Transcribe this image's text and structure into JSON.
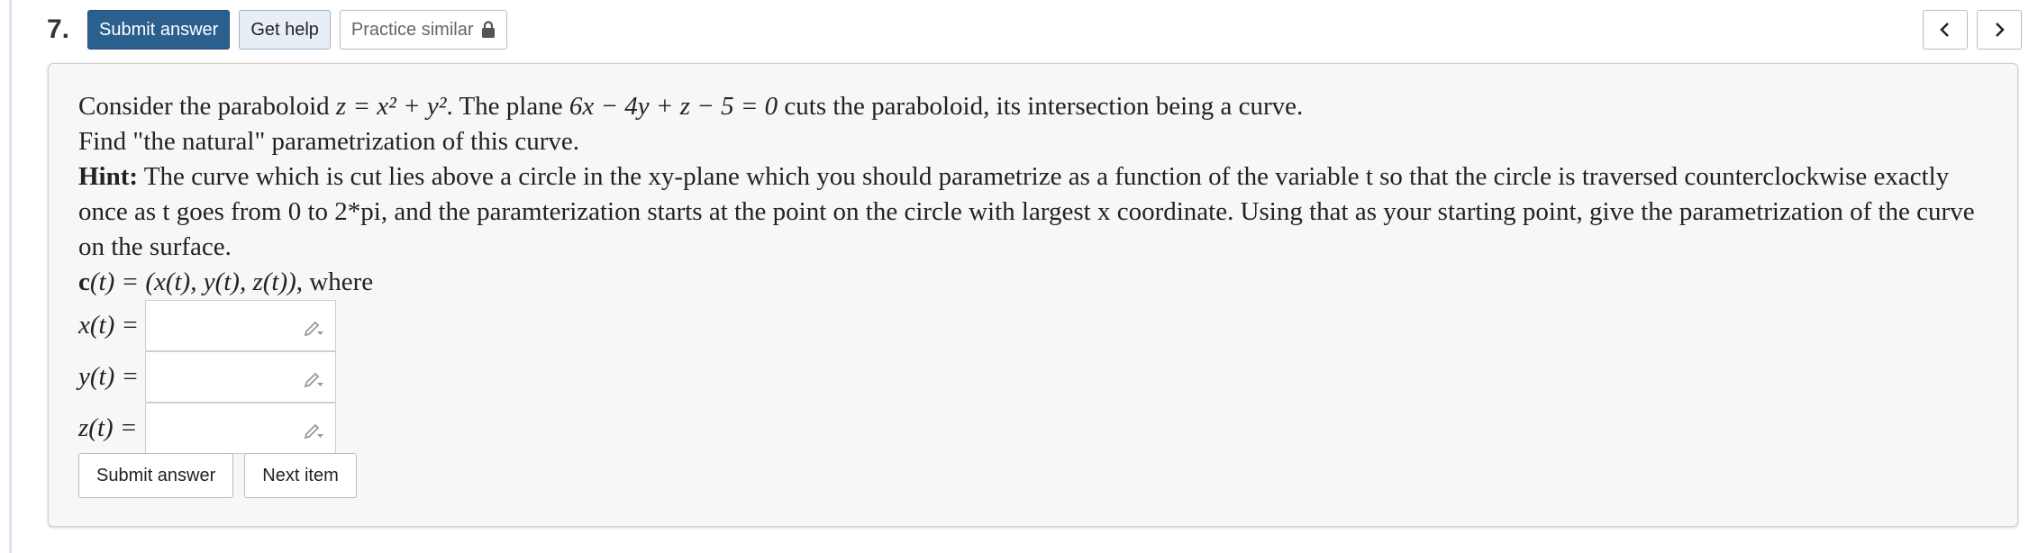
{
  "question": {
    "number": "7.",
    "submit_label": "Submit answer",
    "help_label": "Get help",
    "practice_label": "Practice similar"
  },
  "nav": {
    "prev_icon": "chevron-left-icon",
    "next_icon": "chevron-right-icon"
  },
  "problem": {
    "line1_pre": "Consider the paraboloid ",
    "paraboloid_eq": "z = x² + y²",
    "line1_mid": ". The plane ",
    "plane_eq": "6x − 4y + z − 5 = 0",
    "line1_post": " cuts the paraboloid, its intersection being a curve.",
    "line2": "Find \"the natural\" parametrization of this curve.",
    "hint_label": "Hint:",
    "hint_text": " The curve which is cut lies above a circle in the xy-plane which you should parametrize as a function of the variable t so that the circle is traversed counterclockwise exactly once as t goes from 0 to 2*pi, and the paramterization starts at the point on the circle with largest x coordinate. Using that as your starting point, give the parametrization of the curve on the surface.",
    "param_bold": "c",
    "param_rest": "(t) = (x(t), y(t), z(t))",
    "param_where": ", where"
  },
  "inputs": [
    {
      "label": "x(t) =",
      "value": ""
    },
    {
      "label": "y(t) =",
      "value": ""
    },
    {
      "label": "z(t) =",
      "value": ""
    }
  ],
  "actions": {
    "submit_label": "Submit answer",
    "next_label": "Next item"
  },
  "colors": {
    "primary": "#2b5f8e",
    "help_bg": "#e8eef6",
    "card_bg": "#f7f7f7"
  }
}
